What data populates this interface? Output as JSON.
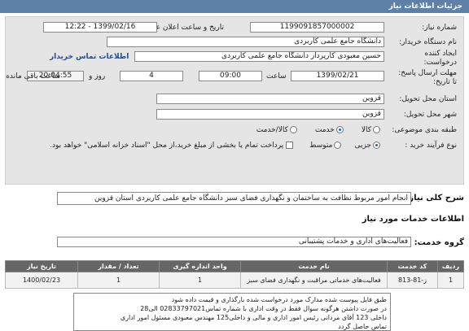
{
  "header": {
    "title": "جزئیات اطلاعات نیاز"
  },
  "form": {
    "need_number": {
      "label": "شماره نیاز:",
      "value": "1199091857000002"
    },
    "announce_date": {
      "label": "تاریخ و ساعت اعلان عمومی:",
      "value": "1399/02/16 - 12:22"
    },
    "buyer_name": {
      "label": "نام دستگاه خریدار:",
      "value": "دانشگاه جامع علمی کاربردی"
    },
    "creator": {
      "label_line1": "ایجاد کننده",
      "label_line2": "درخواست:",
      "value": "حسین معبودی کارپرداز دانشگاه جامع علمی کاربردی"
    },
    "contact_link": "اطلاعات تماس خریدار",
    "deadline": {
      "label_line1": "مهلت ارسال پاسخ:",
      "label_line2": "تا تاریخ:",
      "date": "1399/02/21",
      "time_label": "ساعت",
      "time": "09:00",
      "days": "4",
      "days_label": "روز و",
      "remaining": "20:04:55",
      "remaining_label": "ساعت باقی مانده"
    },
    "province": {
      "label": "استان محل تحویل:",
      "value": "قزوین"
    },
    "city": {
      "label": "شهر محل تحویل:",
      "value": "قزوین"
    },
    "category": {
      "label": "طبقه بندی موضوعی:",
      "options": [
        "کالا",
        "خدمت",
        "کالا/خدمت"
      ]
    },
    "purchase_process": {
      "label": "نوع فرآیند خرید :",
      "options": [
        "جزیی",
        "متوسط"
      ],
      "payment_text": "پرداخت تمام یا بخشی از مبلغ خرید،از محل \"اسناد خزانه اسلامی\" خواهد بود."
    }
  },
  "summary": {
    "label": "شرح کلی نیاز:",
    "value": "انجام امور مربوط نظافت به ساختمان و نگهداری فضای سبز دانشگاه جامع علمی کاربردی استان قزوین"
  },
  "services_section": {
    "title": "اطلاعات خدمات مورد نیاز",
    "group_label": "گروه خدمت:",
    "group_value": "فعالیت‌های اداری و خدمات پشتیبانی"
  },
  "table": {
    "headers": [
      "ردیف",
      "کد خدمت",
      "نام خدمت",
      "واحد اندازه گیری",
      "تعداد / مقدار",
      "تاریخ نیاز"
    ],
    "rows": [
      [
        "1",
        "ز-81-813",
        "فعالیت‌های خدماتی مراقبت و نگهداری فضای سبز",
        "1",
        "1",
        "1400/02/23"
      ]
    ]
  },
  "notes": {
    "lines": [
      "طبق فایل پیوست شده مدارک مورد درخواست شده بارگذاری و قیمت داده شود",
      "در صورت داشتن هرگونه سوال فقط در وقت اداری با شماره تماس02833797021 الی28",
      "داخلی 123 آقای مردانی رئیس امور اداری و مالی و داخلی125 مهندس معبودی مسئول امور اداری",
      "تماس حاصل گردد"
    ]
  }
}
